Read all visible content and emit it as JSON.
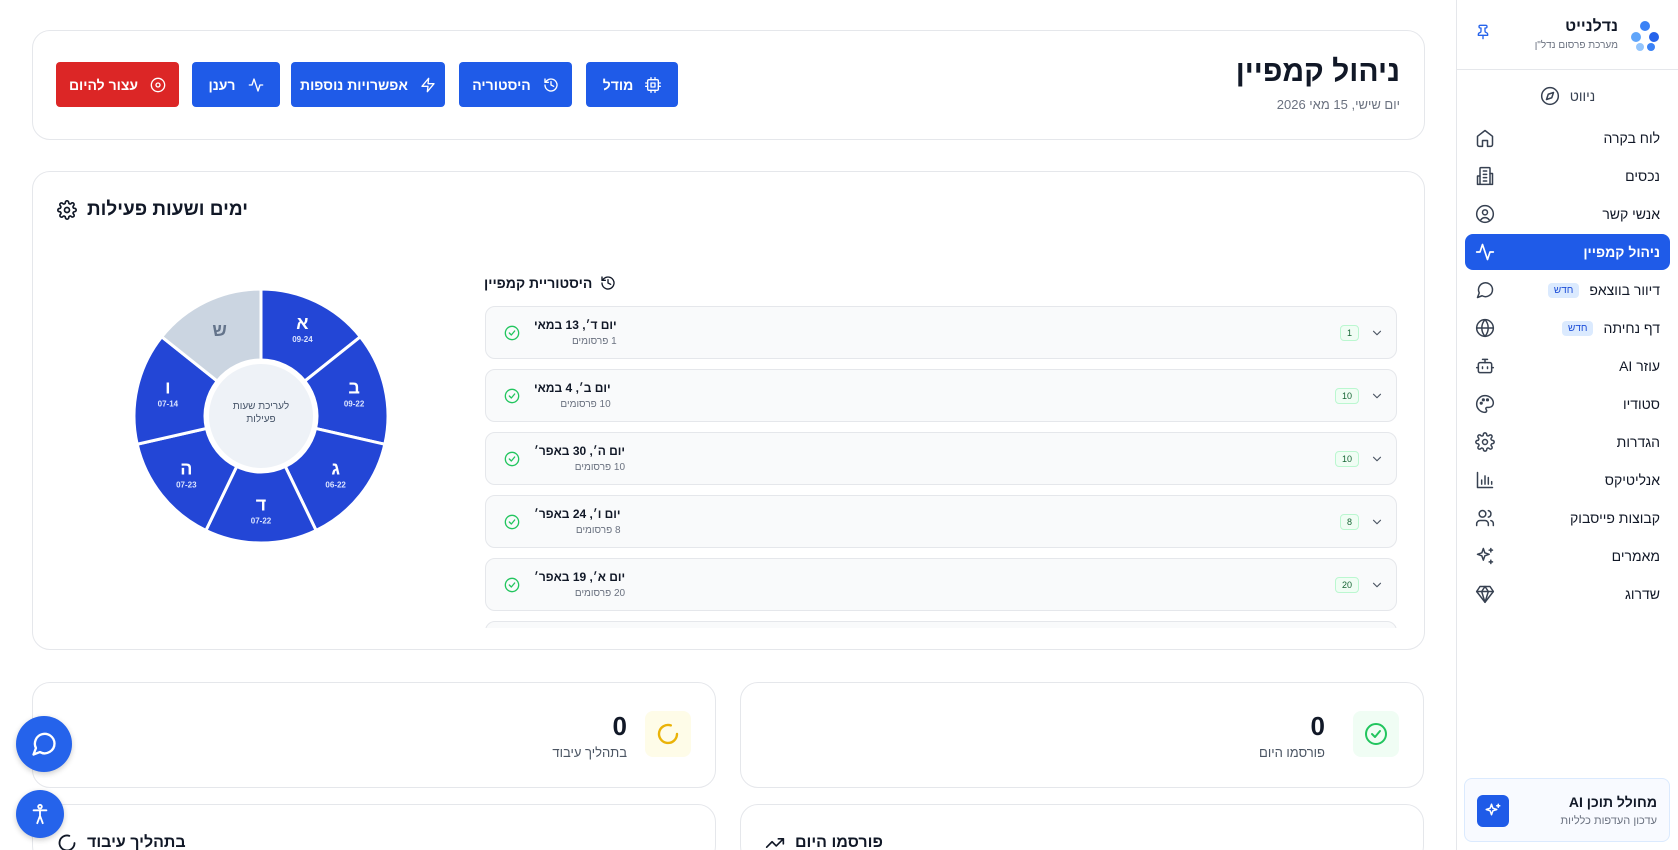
{
  "sidebar": {
    "brand_name": "נדלנייט",
    "brand_sub": "מערכת פרסום נדל\"ן",
    "nav_heading": "ניווט",
    "items": [
      {
        "label": "לוח בקרה",
        "icon": "home-icon"
      },
      {
        "label": "נכסים",
        "icon": "building-icon"
      },
      {
        "label": "אנשי קשר",
        "icon": "user-circle-icon"
      },
      {
        "label": "ניהול קמפיין",
        "icon": "activity-icon",
        "active": true
      },
      {
        "label": "דיוור בווצאפ",
        "icon": "message-circle-icon",
        "badge": "חדש"
      },
      {
        "label": "דף נחיתה",
        "icon": "globe-icon",
        "badge": "חדש"
      },
      {
        "label": "עוזר AI",
        "icon": "bot-icon"
      },
      {
        "label": "סטודיו",
        "icon": "palette-icon"
      },
      {
        "label": "הגדרות",
        "icon": "gear-icon"
      },
      {
        "label": "אנליטיקס",
        "icon": "bar-chart-icon"
      },
      {
        "label": "קבוצות פייסבוק",
        "icon": "users-icon"
      },
      {
        "label": "מאמרים",
        "icon": "sparkles-icon"
      },
      {
        "label": "שדרוג",
        "icon": "gem-icon"
      }
    ],
    "badge_new": "חדש",
    "promo": {
      "title": "מחולל תוכן AI",
      "subtitle": "עדכון העדפות כלליות"
    }
  },
  "header": {
    "title": "ניהול קמפיין",
    "date": "יום שישי, 15 מאי 2026",
    "buttons": {
      "model": "מודל",
      "history": "היסטוריה",
      "more_options": "אפשרויות נוספות",
      "refresh": "רענן",
      "stop_today": "עצור להיום"
    }
  },
  "hours": {
    "title": "ימים ושעות פעילות",
    "center_label": "לעריכת שעות פעילות",
    "days": [
      {
        "letter": "א",
        "hours": "09-24",
        "active": true
      },
      {
        "letter": "ב",
        "hours": "09-22",
        "active": true
      },
      {
        "letter": "ג",
        "hours": "06-22",
        "active": true
      },
      {
        "letter": "ד",
        "hours": "07-22",
        "active": true
      },
      {
        "letter": "ה",
        "hours": "07-23",
        "active": true
      },
      {
        "letter": "ו",
        "hours": "07-14",
        "active": true
      },
      {
        "letter": "ש",
        "hours": "",
        "active": false
      }
    ],
    "colors": {
      "active": "#2346d6",
      "inactive": "#cbd5e1",
      "center": "#eef2f7"
    }
  },
  "history": {
    "title": "היסטוריית קמפיין",
    "items": [
      {
        "date": "יום ד׳, 13 במאי",
        "sub": "1 פרסומים",
        "count": "1"
      },
      {
        "date": "יום ב׳, 4 במאי",
        "sub": "10 פרסומים",
        "count": "10"
      },
      {
        "date": "יום ה׳, 30 באפר׳",
        "sub": "10 פרסומים",
        "count": "10"
      },
      {
        "date": "יום ו׳, 24 באפר׳",
        "sub": "8 פרסומים",
        "count": "8"
      },
      {
        "date": "יום א׳, 19 באפר׳",
        "sub": "20 פרסומים",
        "count": "20"
      }
    ]
  },
  "stats": {
    "published_today": {
      "value": "0",
      "label": "פורסמו היום",
      "icon": "check-circle-icon"
    },
    "in_progress": {
      "value": "0",
      "label": "בתהליך עיבוד",
      "icon": "loader-icon"
    }
  },
  "bottom": {
    "published_today_title": "פורסמו היום",
    "in_progress_title": "בתהליך עיבוד"
  },
  "fabs": {
    "chat": "message-circle-icon",
    "accessibility": "accessibility-icon"
  }
}
